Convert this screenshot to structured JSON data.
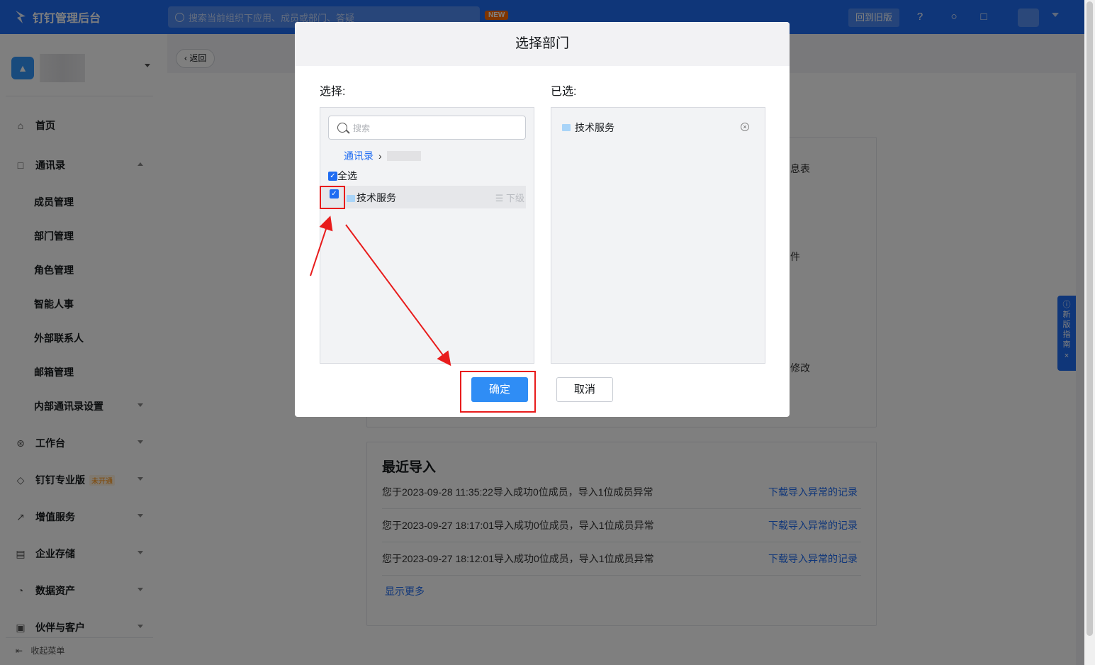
{
  "topbar": {
    "app_title": "钉钉管理后台",
    "search_placeholder": "搜索当前组织下应用、成员或部门、答疑",
    "new_badge": "NEW",
    "old_version_label": "回到旧版"
  },
  "sidebar": {
    "home": "首页",
    "contacts": "通讯录",
    "contacts_sub": [
      "成员管理",
      "部门管理",
      "角色管理",
      "智能人事",
      "外部联系人",
      "邮箱管理",
      "内部通讯录设置"
    ],
    "workbench": "工作台",
    "pro": "钉钉专业版",
    "pro_badge": "未开通",
    "value_added": "增值服务",
    "storage": "企业存储",
    "data_assets": "数据资产",
    "partners": "伙伴与客户",
    "collapse": "收起菜单"
  },
  "main": {
    "back_label": "返回",
    "frag_1": "息表",
    "frag_2": "件",
    "frag_3": "修改",
    "recent_title": "最近导入",
    "imports": [
      {
        "text": "您于2023-09-28 11:35:22导入成功0位成员，导入1位成员异常",
        "link": "下载导入异常的记录"
      },
      {
        "text": "您于2023-09-27 18:17:01导入成功0位成员，导入1位成员异常",
        "link": "下载导入异常的记录"
      },
      {
        "text": "您于2023-09-27 18:12:01导入成功0位成员，导入1位成员异常",
        "link": "下载导入异常的记录"
      }
    ],
    "show_more": "显示更多",
    "guide_label": "新版指南"
  },
  "modal": {
    "title": "选择部门",
    "select_label": "选择:",
    "selected_label": "已选:",
    "search_placeholder": "搜索",
    "breadcrumb_root": "通讯录",
    "select_all": "全选",
    "dept_name": "技术服务",
    "sub_level": "下级",
    "selected_item": "技术服务",
    "ok": "确定",
    "cancel": "取消"
  },
  "colors": {
    "brand": "#1f6cf2",
    "confirm": "#2f8df5",
    "annotation": "#e81c1c"
  }
}
